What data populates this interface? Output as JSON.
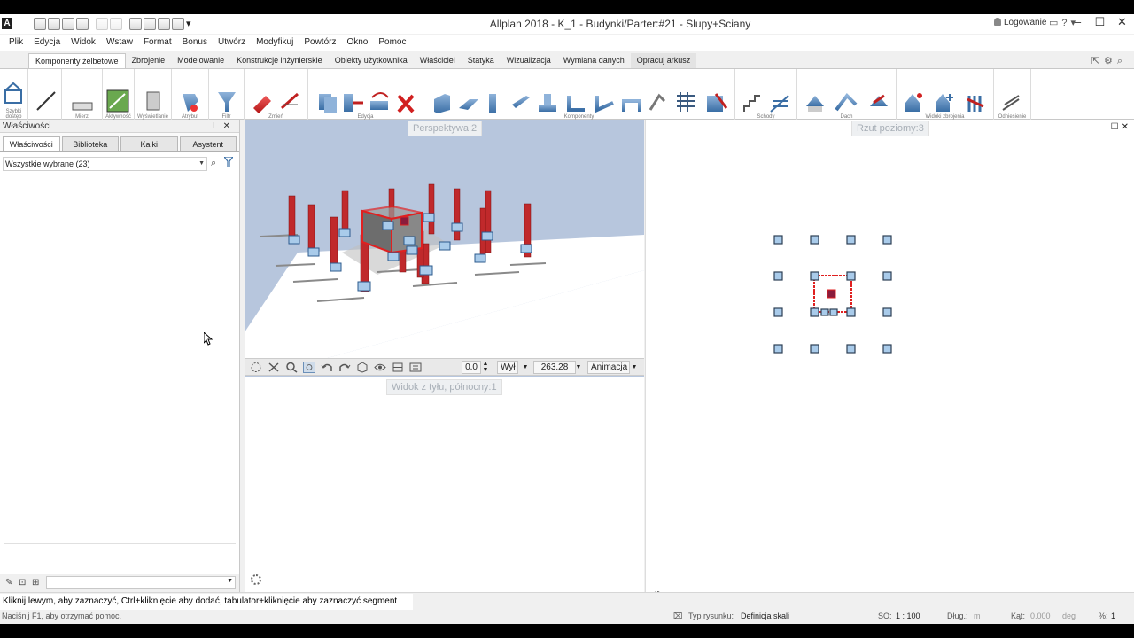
{
  "title_bar": {
    "app_icon": "A",
    "title": "Allplan 2018 - K_1 - Budynki/Parter:#21 - Slupy+Sciany",
    "login": "Logowanie",
    "icons": [
      "cart-icon",
      "help-icon",
      "chevron-down-icon"
    ]
  },
  "menu": [
    "Plik",
    "Edycja",
    "Widok",
    "Wstaw",
    "Format",
    "Bonus",
    "Utwórz",
    "Modyfikuj",
    "Powtórz",
    "Okno",
    "Pomoc"
  ],
  "ribbon": {
    "tabs": [
      "Komponenty żelbetowe",
      "Zbrojenie",
      "Modelowanie",
      "Konstrukcje inżynierskie",
      "Obiekty użytkownika",
      "Właściciel",
      "Statyka",
      "Wizualizacja",
      "Wymiana danych",
      "Opracuj arkusz"
    ],
    "active_tab": 0,
    "groups": [
      "Szybki dostęp",
      "Mierz",
      "Aktywność",
      "Wyświetlanie",
      "Atrybut",
      "Filtr",
      "Zmień",
      "Edycja",
      "Komponenty",
      "Schody",
      "Dach",
      "Widoki zbrojenia",
      "Odniesienie"
    ]
  },
  "left_panel": {
    "title": "Właściwości",
    "tabs": [
      "Właściwości",
      "Biblioteka",
      "Kalki",
      "Asystent"
    ],
    "active_tab": 0,
    "selection": "Wszystkie wybrane (23)"
  },
  "viewports": {
    "perspective": "Perspektywa:2",
    "plan": "Rzut poziomy:3",
    "back": "Widok z tyłu, północny:1"
  },
  "navbar": {
    "angle": "0.0",
    "mode": "Wył",
    "zoom": "263.28",
    "animation": "Animacja"
  },
  "status": {
    "prompt": "Kliknij lewym, aby zaznaczyć, Ctrl+kliknięcie aby dodać, tabulator+kliknięcie aby zaznaczyć segment",
    "help": "Naciśnij F1, aby otrzymać pomoc.",
    "drawing_type_label": "Typ rysunku:",
    "drawing_type_value": "Definicja skali",
    "scale_label": "SO:",
    "scale_value": "1 : 100",
    "length_label": "Dług.:",
    "length_value": "m",
    "angle_label": "Kąt:",
    "angle_value": "0.000",
    "angle_unit": "deg",
    "percent_label": "%:",
    "percent_value": "1"
  },
  "colors": {
    "selection": "#e02020",
    "column": "#c0292b",
    "handle": "#a9cbea",
    "sky": "#b7c6dd"
  }
}
